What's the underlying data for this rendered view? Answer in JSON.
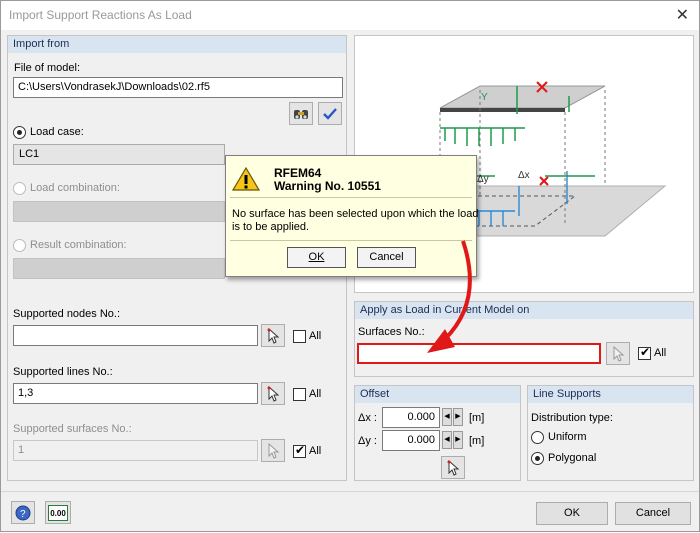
{
  "window": {
    "title": "Import Support Reactions As Load"
  },
  "import_from": {
    "header": "Import from",
    "file_label": "File of model:",
    "file_path": "C:\\Users\\VondrasekJ\\Downloads\\02.rf5",
    "load_case_label": "Load case:",
    "load_case_value": "LC1",
    "load_combination_label": "Load combination:",
    "result_combination_label": "Result combination:",
    "supported_nodes_label": "Supported nodes No.:",
    "supported_nodes_value": "",
    "supported_lines_label": "Supported lines No.:",
    "supported_lines_value": "1,3",
    "supported_surfaces_label": "Supported surfaces No.:",
    "supported_surfaces_value": "1",
    "all_label": "All"
  },
  "apply": {
    "header": "Apply as Load in Current Model on",
    "surfaces_label": "Surfaces No.:",
    "surfaces_value": "",
    "all_label": "All"
  },
  "offset": {
    "header": "Offset",
    "dx_label": "Δx :",
    "dx_value": "0.000",
    "dy_label": "Δy :",
    "dy_value": "0.000",
    "unit": "[m]"
  },
  "line_supports": {
    "header": "Line Supports",
    "distribution_label": "Distribution type:",
    "options": [
      "Uniform",
      "Polygonal"
    ],
    "selected": "Polygonal"
  },
  "footer": {
    "ok": "OK",
    "cancel": "Cancel",
    "units_badge": "0.00"
  },
  "message_box": {
    "app": "RFEM64",
    "warning": "Warning No. 10551",
    "text_line1": "No surface has been selected upon which the load",
    "text_line2": "is to be applied.",
    "ok": "OK",
    "cancel": "Cancel"
  },
  "preview_labels": {
    "dx": "Δx",
    "dy": "Δy"
  },
  "colors": {
    "accent_red": "#e01818",
    "group_header": "#d8e4f0"
  }
}
